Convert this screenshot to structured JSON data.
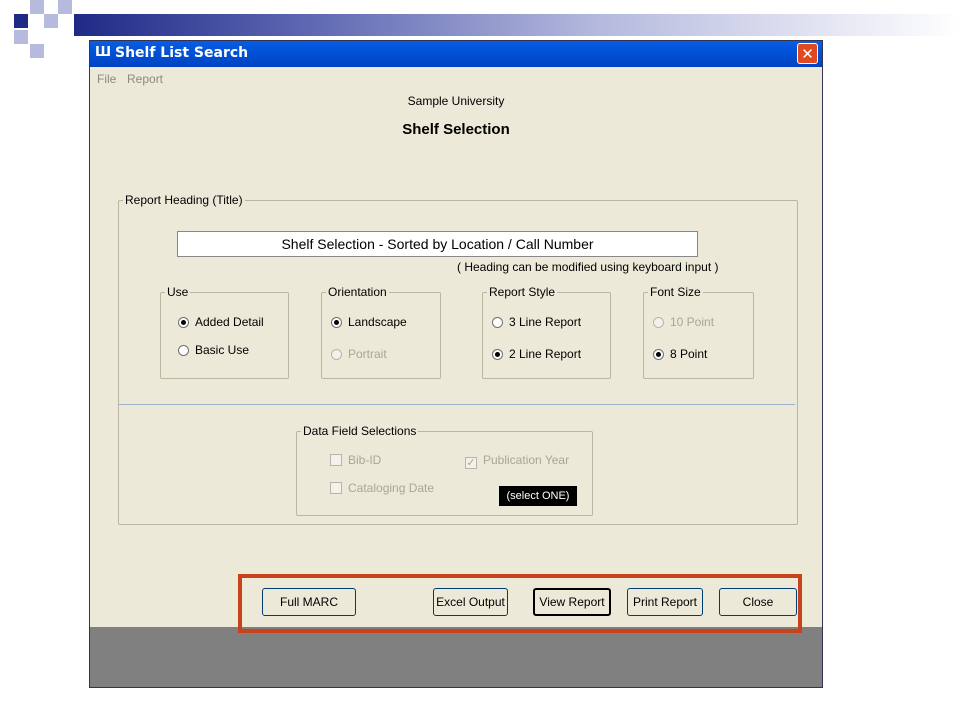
{
  "window": {
    "title": "Shelf List Search",
    "close_glyph": "✕",
    "app_icon_glyph": "Ш"
  },
  "menu": [
    "File",
    "Report"
  ],
  "header": {
    "organization": "Sample University",
    "title": "Shelf Selection"
  },
  "report_heading": {
    "legend": "Report Heading (Title)",
    "value": "Shelf Selection - Sorted by Location / Call Number",
    "hint": "( Heading can be modified using keyboard input )"
  },
  "use": {
    "legend": "Use",
    "options": [
      {
        "label": "Added Detail",
        "selected": true,
        "enabled": true
      },
      {
        "label": "Basic Use",
        "selected": false,
        "enabled": true
      }
    ]
  },
  "orientation": {
    "legend": "Orientation",
    "options": [
      {
        "label": "Landscape",
        "selected": true,
        "enabled": true
      },
      {
        "label": "Portrait",
        "selected": false,
        "enabled": false
      }
    ]
  },
  "report_style": {
    "legend": "Report Style",
    "options": [
      {
        "label": "3 Line Report",
        "selected": false,
        "enabled": true
      },
      {
        "label": "2 Line Report",
        "selected": true,
        "enabled": true
      }
    ]
  },
  "font_size": {
    "legend": "Font Size",
    "options": [
      {
        "label": "10  Point",
        "selected": false,
        "enabled": false
      },
      {
        "label": "8  Point",
        "selected": true,
        "enabled": true
      }
    ]
  },
  "data_fields": {
    "legend": "Data Field Selections",
    "checkboxes": [
      {
        "label": "Bib-ID",
        "checked": false,
        "enabled": false
      },
      {
        "label": "Publication Year",
        "checked": true,
        "enabled": false
      },
      {
        "label": "Cataloging Date",
        "checked": false,
        "enabled": false
      }
    ],
    "select_hint": "(select ONE)"
  },
  "buttons": {
    "full_marc": "Full MARC",
    "excel_output": "Excel Output",
    "view_report": "View Report",
    "print_report": "Print Report",
    "close": "Close"
  },
  "colors": {
    "highlight_border": "#c8421c",
    "titlebar": "#0152d9",
    "window_bg": "#ece9d8"
  }
}
